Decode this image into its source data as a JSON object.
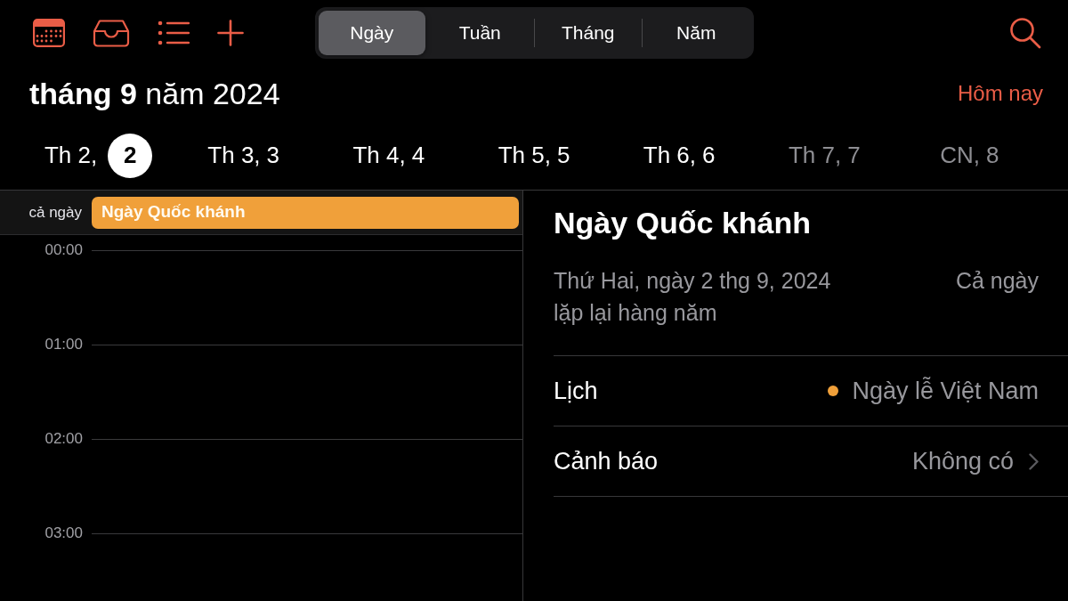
{
  "view_tabs": [
    {
      "label": "Ngày",
      "selected": true
    },
    {
      "label": "Tuần",
      "selected": false
    },
    {
      "label": "Tháng",
      "selected": false
    },
    {
      "label": "Năm",
      "selected": false
    }
  ],
  "header": {
    "title": "**tháng 9** năm 2024",
    "today_button": "Hôm nay"
  },
  "week_days": [
    {
      "day": "Th 2,",
      "date": "2",
      "selected": true,
      "weekend": false
    },
    {
      "day": "Th 3,",
      "date": "3",
      "selected": false,
      "weekend": false
    },
    {
      "day": "Th 4,",
      "date": "4",
      "selected": false,
      "weekend": false
    },
    {
      "day": "Th 5,",
      "date": "5",
      "selected": false,
      "weekend": false
    },
    {
      "day": "Th 6,",
      "date": "6",
      "selected": false,
      "weekend": false
    },
    {
      "day": "Th 7,",
      "date": "7",
      "selected": false,
      "weekend": true
    },
    {
      "day": "CN,",
      "date": "8",
      "selected": false,
      "weekend": true
    }
  ],
  "all_day": {
    "label": "cả ngày",
    "events": [
      {
        "title": "Ngày Quốc khánh",
        "color": "#f0a03a"
      }
    ]
  },
  "hours": [
    "00:00",
    "01:00",
    "02:00",
    "03:00"
  ],
  "event_detail": {
    "title": "Ngày Quốc khánh",
    "date": "Thứ Hai, ngày 2 thg 9, 2024",
    "time": "Cả ngày",
    "repeat": "lặp lại hàng năm",
    "rows": [
      {
        "kind": "calendar",
        "label": "Lịch",
        "value": "Ngày lễ Việt Nam",
        "color": "#f0a03a"
      },
      {
        "kind": "link",
        "label": "Cảnh báo",
        "value": "Không có"
      }
    ]
  }
}
